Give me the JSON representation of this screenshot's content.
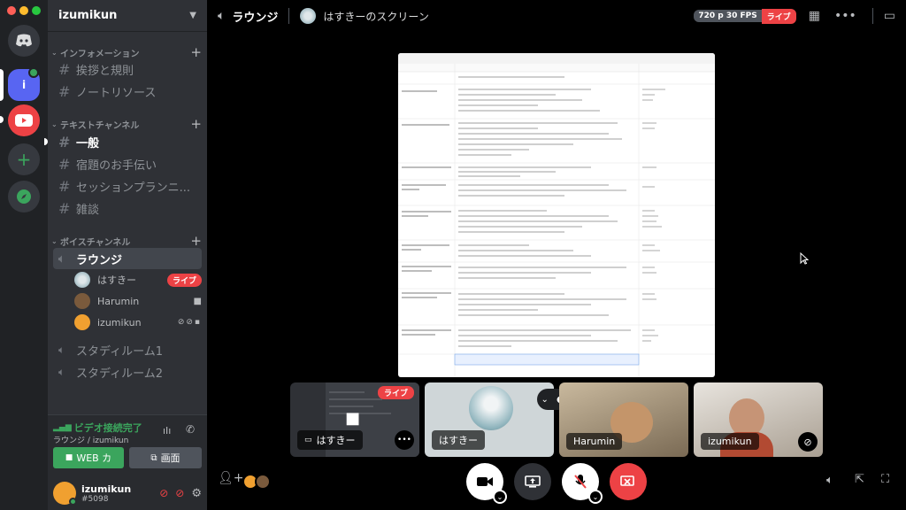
{
  "server": {
    "name": "izumikun"
  },
  "categories": {
    "info": "インフォメーション",
    "text": "テキストチャンネル",
    "voice": "ボイスチャンネル"
  },
  "info_channels": [
    "挨拶と規則",
    "ノートリソース"
  ],
  "text_channels": [
    "一般",
    "宿題のお手伝い",
    "セッションプランニ...",
    "雑談"
  ],
  "voice_channels": {
    "lounge": "ラウンジ",
    "study1": "スタディルーム1",
    "study2": "スタディルーム2"
  },
  "voice_users": [
    {
      "name": "はすきー",
      "badge": "ライブ"
    },
    {
      "name": "Harumin"
    },
    {
      "name": "izumikun"
    }
  ],
  "voice_status": {
    "title": "ビデオ接続完了",
    "subtitle": "ラウンジ / izumikun",
    "web_button": "WEB カ",
    "screen_button": "画面"
  },
  "user": {
    "name": "izumikun",
    "tag": "#5098"
  },
  "topbar": {
    "channel": "ラウンジ",
    "stream_title": "はすきーのスクリーン",
    "quality": "720 p 30 FPS",
    "live": "ライブ"
  },
  "tiles": {
    "live_label": "ライブ",
    "screen_user": "はすきー",
    "cam1": "はすきー",
    "cam2": "Harumin",
    "cam3": "izumikun"
  },
  "colors": {
    "accent_green": "#3ba55d",
    "live_red": "#ed4245",
    "blurple": "#5865f2"
  }
}
